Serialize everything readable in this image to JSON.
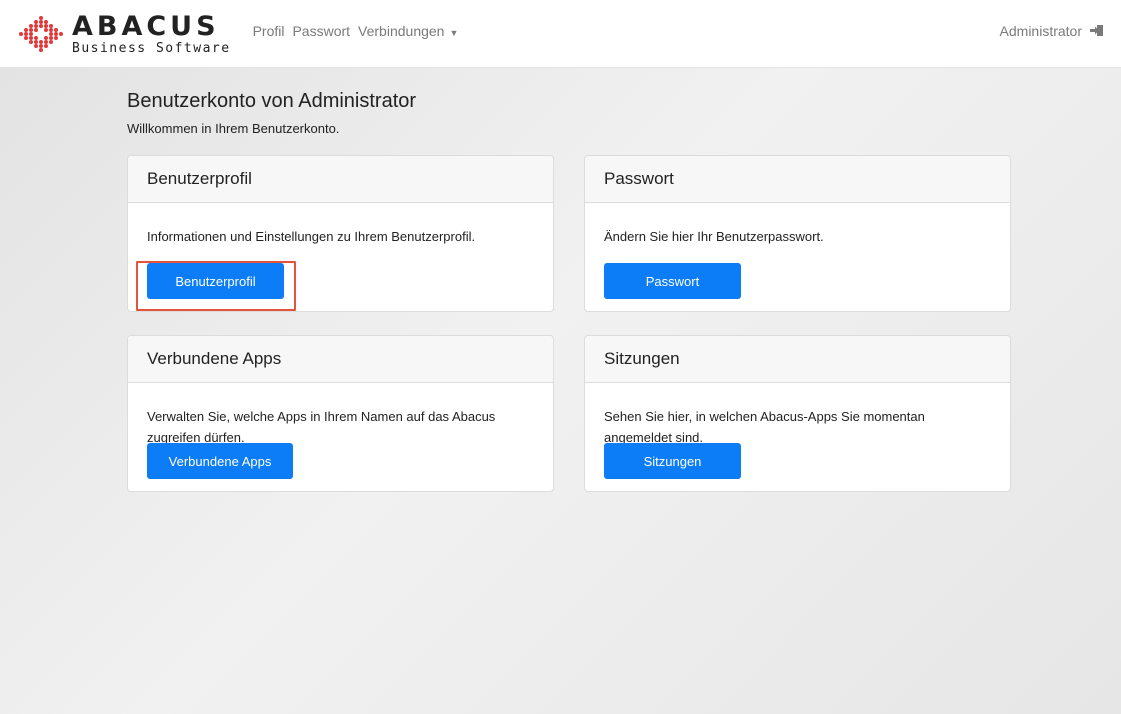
{
  "brand": {
    "name": "ABACUS",
    "subtitle": "Business Software"
  },
  "nav": {
    "links": [
      "Profil",
      "Passwort",
      "Verbindungen"
    ],
    "user": "Administrator"
  },
  "page": {
    "title": "Benutzerkonto von Administrator",
    "welcome": "Willkommen in Ihrem Benutzerkonto."
  },
  "cards": [
    {
      "title": "Benutzerprofil",
      "text": "Informationen und Einstellungen zu Ihrem Benutzerprofil.",
      "button": "Benutzerprofil"
    },
    {
      "title": "Passwort",
      "text": "Ändern Sie hier Ihr Benutzerpasswort.",
      "button": "Passwort"
    },
    {
      "title": "Verbundene Apps",
      "text": "Verwalten Sie, welche Apps in Ihrem Namen auf das Abacus zugreifen dürfen.",
      "button": "Verbundene Apps"
    },
    {
      "title": "Sitzungen",
      "text": "Sehen Sie hier, in welchen Abacus-Apps Sie momentan angemeldet sind.",
      "button": "Sitzungen"
    }
  ],
  "colors": {
    "primary": "#0d7df7",
    "logo_red": "#e03a3a",
    "highlight": "#e5533d"
  },
  "icons": {
    "dropdown": "caret-down-icon",
    "logout": "logout-icon"
  }
}
